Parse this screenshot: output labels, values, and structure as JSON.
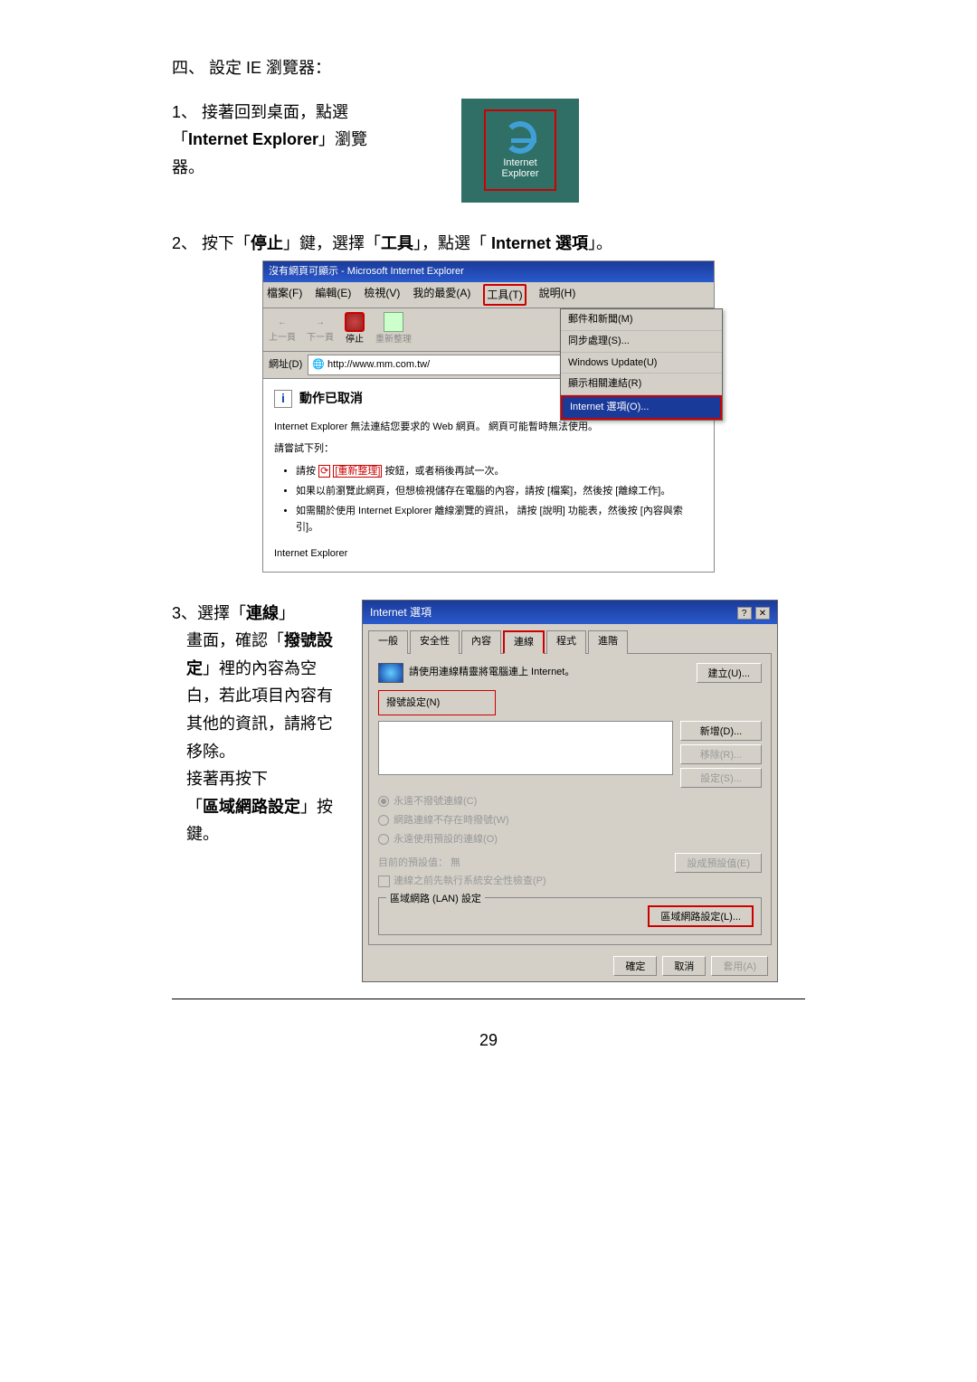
{
  "section": {
    "title": "四、 設定 IE 瀏覽器："
  },
  "step1": {
    "num": "1、",
    "text": "接著回到桌面，點選「",
    "bold": "Internet Explorer",
    "text2": "」瀏覽器。",
    "icon_label_l1": "Internet",
    "icon_label_l2": "Explorer"
  },
  "step2": {
    "num": "2、",
    "text_a": "按下「",
    "bold_a": "停止",
    "text_b": "」鍵，選擇「",
    "bold_b": "工具",
    "text_c": "」，點選「 ",
    "bold_c": "Internet 選項",
    "text_d": "」。",
    "win_title": "沒有網頁可顯示 - Microsoft Internet Explorer",
    "menu": {
      "file": "檔案(F)",
      "edit": "編輯(E)",
      "view": "檢視(V)",
      "fav": "我的最愛(A)",
      "tools": "工具(T)",
      "help": "說明(H)"
    },
    "tb": {
      "back": "上一頁",
      "fwd": "下一頁",
      "stop": "停止",
      "refresh": "重新整理"
    },
    "addr_label": "網址(D)",
    "addr_value": "http://www.mm.com.tw/",
    "dropdown": {
      "mail": "郵件和新聞(M)",
      "sync": "同步處理(S)...",
      "wu": "Windows Update(U)",
      "related": "顯示相關連結(R)",
      "options": "Internet 選項(O)..."
    },
    "body": {
      "cancelled": "動作已取消",
      "p1": "Internet Explorer 無法連結您要求的 Web 網頁。 網頁可能暫時無法使用。",
      "p2": "請嘗試下列：",
      "li1a": "請按 ",
      "li1b": "[重新整理]",
      "li1c": " 按鈕，或者稍後再試一次。",
      "li2": "如果以前瀏覽此網頁，但想檢視儲存在電腦的內容，請按 [檔案]，然後按 [離線工作]。",
      "li3": "如需關於使用 Internet Explorer 離線瀏覽的資訊， 請按 [說明] 功能表，然後按 [內容與索引]。",
      "footer": "Internet Explorer"
    }
  },
  "step3": {
    "num": "3、",
    "line1_a": "選擇「",
    "line1_b": "連線",
    "line1_c": "」",
    "line2_a": "畫面，確認「",
    "line2_b": "撥號設定",
    "line2_c": "」裡的內容為空白，若此項目內容有其他的資訊，請將它移除。",
    "line3": "接著再按下",
    "line4_a": "「",
    "line4_b": "區域網路設定",
    "line4_c": "」按鍵。",
    "dlg": {
      "title": "Internet 選項",
      "tabs": {
        "general": "一般",
        "security": "安全性",
        "content": "內容",
        "conn": "連線",
        "prog": "程式",
        "adv": "進階"
      },
      "conn_text": "請使用連線精靈將電腦連上 Internet。",
      "btn_setup": "建立(U)...",
      "dial_label": "撥號設定(N)",
      "btn_add": "新增(D)...",
      "btn_remove": "移除(R)...",
      "btn_settings": "設定(S)...",
      "radio1": "永遠不撥號連線(C)",
      "radio2": "網路連線不存在時撥號(W)",
      "radio3": "永遠使用預設的連線(O)",
      "default_label": "目前的預設值：   無",
      "btn_default": "設成預設值(E)",
      "chk_sys": "連線之前先執行系統安全性檢查(P)",
      "lan_legend": "區域網路 (LAN) 設定",
      "btn_lan": "區域網路設定(L)...",
      "ok": "確定",
      "cancel": "取消",
      "apply": "套用(A)"
    }
  },
  "page_num": "29"
}
